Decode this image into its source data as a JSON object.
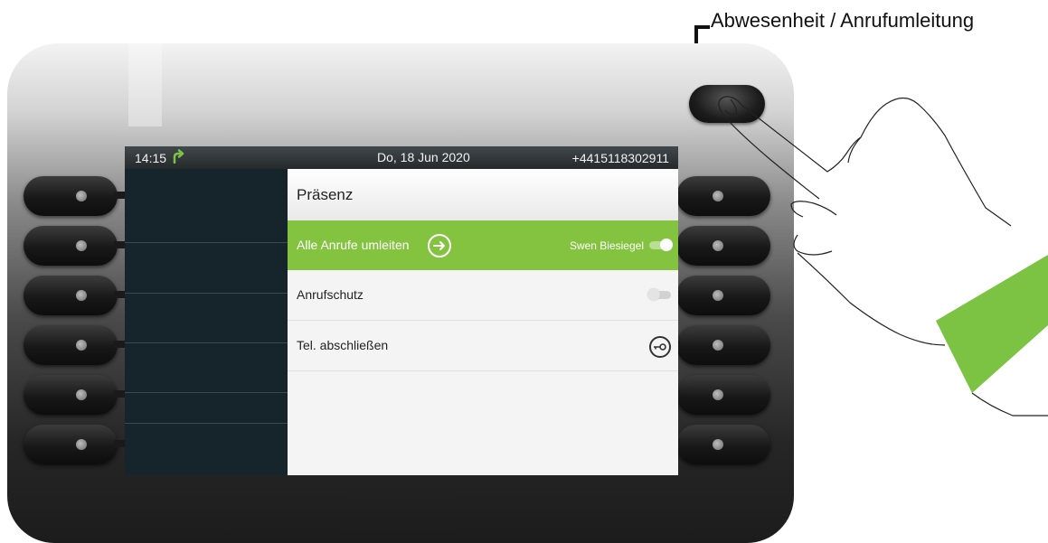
{
  "callout": {
    "label": "Abwesenheit / Anrufumleitung"
  },
  "status_bar": {
    "time": "14:15",
    "date": "Do, 18 Jun 2020",
    "number": "+4415118302911",
    "icon": "call-forward-icon",
    "icon_color": "#7cc243"
  },
  "menu": {
    "title": "Präsenz",
    "items": [
      {
        "label": "Alle Anrufe umleiten",
        "value": "Swen Biesiegel",
        "icon": "arrow-right-circle-icon",
        "toggle": "on",
        "selected": true
      },
      {
        "label": "Anrufschutz",
        "toggle": "off",
        "selected": false
      },
      {
        "label": "Tel. abschließen",
        "icon": "key-lock-icon",
        "selected": false
      }
    ]
  },
  "colors": {
    "accent_green": "#84c340",
    "screen_dark": "#16242c",
    "sleeve_green": "#7cc243"
  }
}
